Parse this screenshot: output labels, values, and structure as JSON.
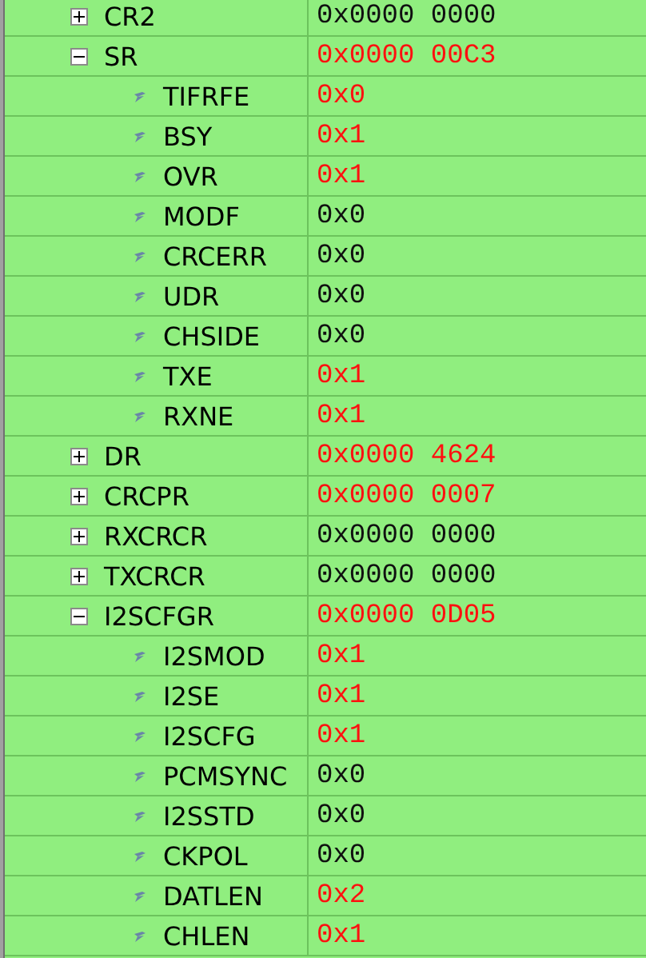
{
  "registers": [
    {
      "name": "CR2",
      "value": "0x0000 0000",
      "changed": false,
      "expanded": false
    },
    {
      "name": "SR",
      "value": "0x0000 00C3",
      "changed": true,
      "expanded": true,
      "children": [
        {
          "name": "TIFRFE",
          "value": "0x0",
          "changed": true
        },
        {
          "name": "BSY",
          "value": "0x1",
          "changed": true
        },
        {
          "name": "OVR",
          "value": "0x1",
          "changed": true
        },
        {
          "name": "MODF",
          "value": "0x0",
          "changed": false
        },
        {
          "name": "CRCERR",
          "value": "0x0",
          "changed": false
        },
        {
          "name": "UDR",
          "value": "0x0",
          "changed": false
        },
        {
          "name": "CHSIDE",
          "value": "0x0",
          "changed": false
        },
        {
          "name": "TXE",
          "value": "0x1",
          "changed": true
        },
        {
          "name": "RXNE",
          "value": "0x1",
          "changed": true
        }
      ]
    },
    {
      "name": "DR",
      "value": "0x0000 4624",
      "changed": true,
      "expanded": false
    },
    {
      "name": "CRCPR",
      "value": "0x0000 0007",
      "changed": true,
      "expanded": false
    },
    {
      "name": "RXCRCR",
      "value": "0x0000 0000",
      "changed": false,
      "expanded": false
    },
    {
      "name": "TXCRCR",
      "value": "0x0000 0000",
      "changed": false,
      "expanded": false
    },
    {
      "name": "I2SCFGR",
      "value": "0x0000 0D05",
      "changed": true,
      "expanded": true,
      "children": [
        {
          "name": "I2SMOD",
          "value": "0x1",
          "changed": true
        },
        {
          "name": "I2SE",
          "value": "0x1",
          "changed": true
        },
        {
          "name": "I2SCFG",
          "value": "0x1",
          "changed": true
        },
        {
          "name": "PCMSYNC",
          "value": "0x0",
          "changed": false
        },
        {
          "name": "I2SSTD",
          "value": "0x0",
          "changed": false
        },
        {
          "name": "CKPOL",
          "value": "0x0",
          "changed": false
        },
        {
          "name": "DATLEN",
          "value": "0x2",
          "changed": true
        },
        {
          "name": "CHLEN",
          "value": "0x1",
          "changed": true
        }
      ]
    }
  ]
}
